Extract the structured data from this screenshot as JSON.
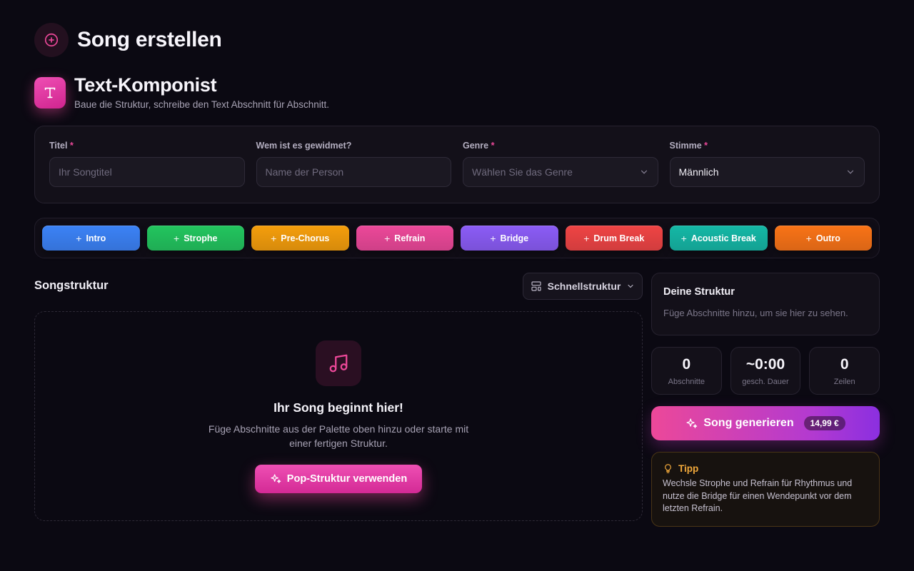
{
  "page": {
    "title": "Song erstellen"
  },
  "composer": {
    "title": "Text-Komponist",
    "subtitle": "Baue die Struktur, schreibe den Text Abschnitt für Abschnitt.",
    "badge_letter": "T"
  },
  "form": {
    "title_label": "Titel",
    "title_placeholder": "Ihr Songtitel",
    "dedication_label": "Wem ist es gewidmet?",
    "dedication_placeholder": "Name der Person",
    "genre_label": "Genre",
    "genre_placeholder": "Wählen Sie das Genre",
    "voice_label": "Stimme",
    "voice_value": "Männlich",
    "required_mark": "*"
  },
  "palette": {
    "items": [
      {
        "label": "Intro",
        "color": "#3b82f6"
      },
      {
        "label": "Strophe",
        "color": "#22c55e"
      },
      {
        "label": "Pre-Chorus",
        "color": "#f59e0b"
      },
      {
        "label": "Refrain",
        "color": "#ec4899"
      },
      {
        "label": "Bridge",
        "color": "#8b5cf6"
      },
      {
        "label": "Drum Break",
        "color": "#ef4444"
      },
      {
        "label": "Acoustic Break",
        "color": "#14b8a6"
      },
      {
        "label": "Outro",
        "color": "#f97316"
      }
    ],
    "plus": "+"
  },
  "structure": {
    "title": "Songstruktur",
    "quick_label": "Schnellstruktur",
    "empty_title": "Ihr Song beginnt hier!",
    "empty_text": "Füge Abschnitte aus der Palette oben hinzu oder starte mit einer fertigen Struktur.",
    "pop_button": "Pop-Struktur verwenden"
  },
  "sidebar": {
    "title": "Deine Struktur",
    "empty_hint": "Füge Abschnitte hinzu, um sie hier zu sehen.",
    "stats": [
      {
        "value": "0",
        "label": "Abschnitte"
      },
      {
        "value": "~0:00",
        "label": "gesch. Dauer"
      },
      {
        "value": "0",
        "label": "Zeilen"
      }
    ],
    "generate_label": "Song generieren",
    "price": "14,99 €",
    "tip_title": "Tipp",
    "tip_text": "Wechsle Strophe und Refrain für Rhythmus und nutze die Bridge für einen Wendepunkt vor dem letzten Refrain."
  },
  "colors": {
    "accent": "#ec4899",
    "background": "#0b0912",
    "tip_accent": "#f2a93b"
  }
}
